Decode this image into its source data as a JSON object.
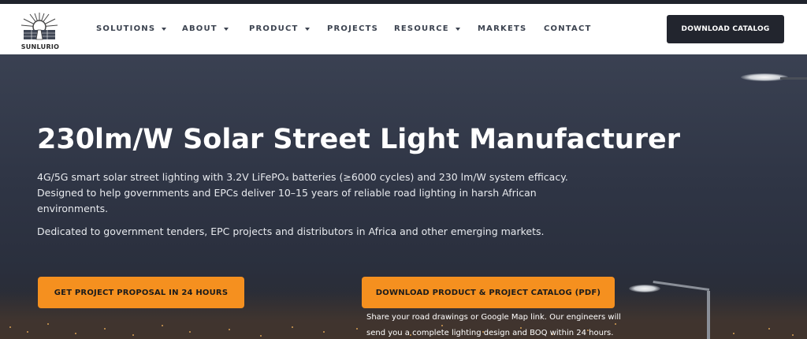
{
  "brand": {
    "name": "SUNLURIO"
  },
  "nav": {
    "items": [
      {
        "label": "SOLUTIONS",
        "dropdown": true
      },
      {
        "label": "ABOUT",
        "dropdown": true
      },
      {
        "label": "PRODUCT",
        "dropdown": true
      },
      {
        "label": "PROJECTS",
        "dropdown": false
      },
      {
        "label": "RESOURCE",
        "dropdown": true
      },
      {
        "label": "MARKETS",
        "dropdown": false
      },
      {
        "label": "CONTACT",
        "dropdown": false
      }
    ],
    "cta_label": "DOWNLOAD CATALOG"
  },
  "hero": {
    "title": "230lm/W Solar Street Light Manufacturer",
    "description_line1": "4G/5G smart solar street lighting with 3.2V LiFePO₄ batteries (≥6000 cycles) and 230 lm/W system efficacy.",
    "description_line2": "Designed to help governments and EPCs deliver 10–15 years of reliable road lighting in harsh African environments.",
    "description_line3": "Dedicated to government tenders, EPC projects and distributors in Africa and other emerging markets.",
    "primary_button": "GET PROJECT PROPOSAL IN 24 HOURS",
    "secondary_button": "DOWNLOAD PRODUCT & PROJECT CATALOG (PDF)",
    "note": "Share your road drawings or Google Map link. Our engineers will send you a complete lighting design and BOQ within 24 hours."
  },
  "colors": {
    "accent": "#f5901f",
    "dark_button": "#22252e",
    "hero_bg": "#2f3545"
  }
}
